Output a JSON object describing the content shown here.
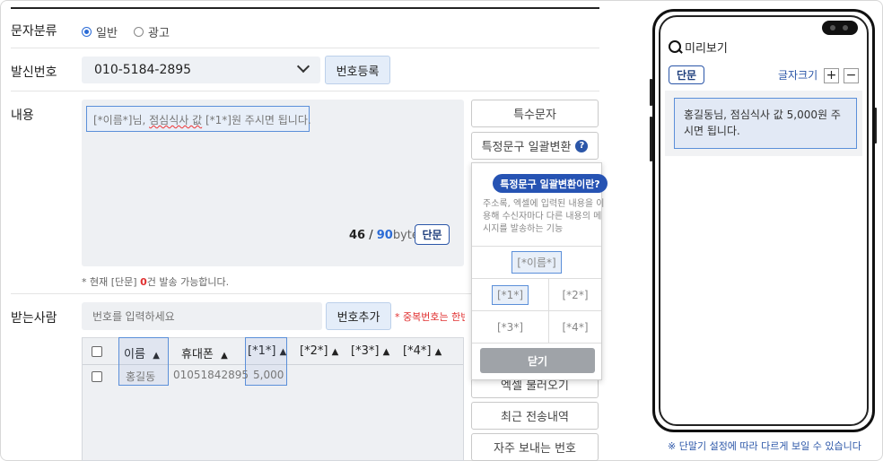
{
  "form": {
    "category_label": "문자분류",
    "category_options": [
      {
        "label": "일반",
        "selected": true
      },
      {
        "label": "광고",
        "selected": false
      }
    ],
    "sender_label": "발신번호",
    "sender_value": "010-5184-2895",
    "register_button": "번호등록",
    "content_label": "내용",
    "message_text_pre": "[*이름*]님, ",
    "message_text_squiggle": "점심식사 값",
    "message_text_post": " [*1*]원 주시면 됩니다.",
    "byte_count": "46",
    "byte_sep": " / ",
    "byte_limit": "90",
    "byte_unit": "byte",
    "type_badge": "단문",
    "note_pre": "* 현재 [단문] ",
    "note_count": "0",
    "note_post": "건 발송 가능합니다.",
    "recipient_label": "받는사람",
    "recipient_placeholder": "번호를 입력하세요",
    "add_number_button": "번호추가",
    "dup_warning": "* 중복번호는 한번만",
    "table": {
      "headers": [
        "이름",
        "휴대폰",
        "[*1*]",
        "[*2*]",
        "[*3*]",
        "[*4*]"
      ],
      "sort_arrow": "▲",
      "rows": [
        {
          "name": "홍길동",
          "phone": "01051842895",
          "v1": "5,000"
        }
      ]
    }
  },
  "side_buttons": {
    "special_chars": "특수문자",
    "bulk_replace": "특정문구 일괄변환",
    "help_icon": "?",
    "excel_load": "엑셀 불러오기",
    "recent_sent": "최근 전송내역",
    "frequent_numbers": "자주 보내는 번호"
  },
  "popup": {
    "title": "특정문구 일괄변환이란?",
    "description": "주소록, 엑셀에 입력된 내용을 이용해 수신자마다 다른 내용의 메시지를 발송하는 기능",
    "name_token": "[*이름*]",
    "tokens": [
      "[*1*]",
      "[*2*]",
      "[*3*]",
      "[*4*]"
    ],
    "close": "닫기"
  },
  "preview": {
    "title": "미리보기",
    "type_badge": "단문",
    "font_size_label": "글자크기",
    "plus": "+",
    "minus": "−",
    "message": "홍길동님, 점심식사 값 5,000원 주시면 됩니다.",
    "footnote": "※ 단말기 설정에 따라 다르게 보일 수 있습니다"
  },
  "colors": {
    "accent": "#2b56a8",
    "highlight_border": "#5b8fd9",
    "warning": "#e03030"
  }
}
